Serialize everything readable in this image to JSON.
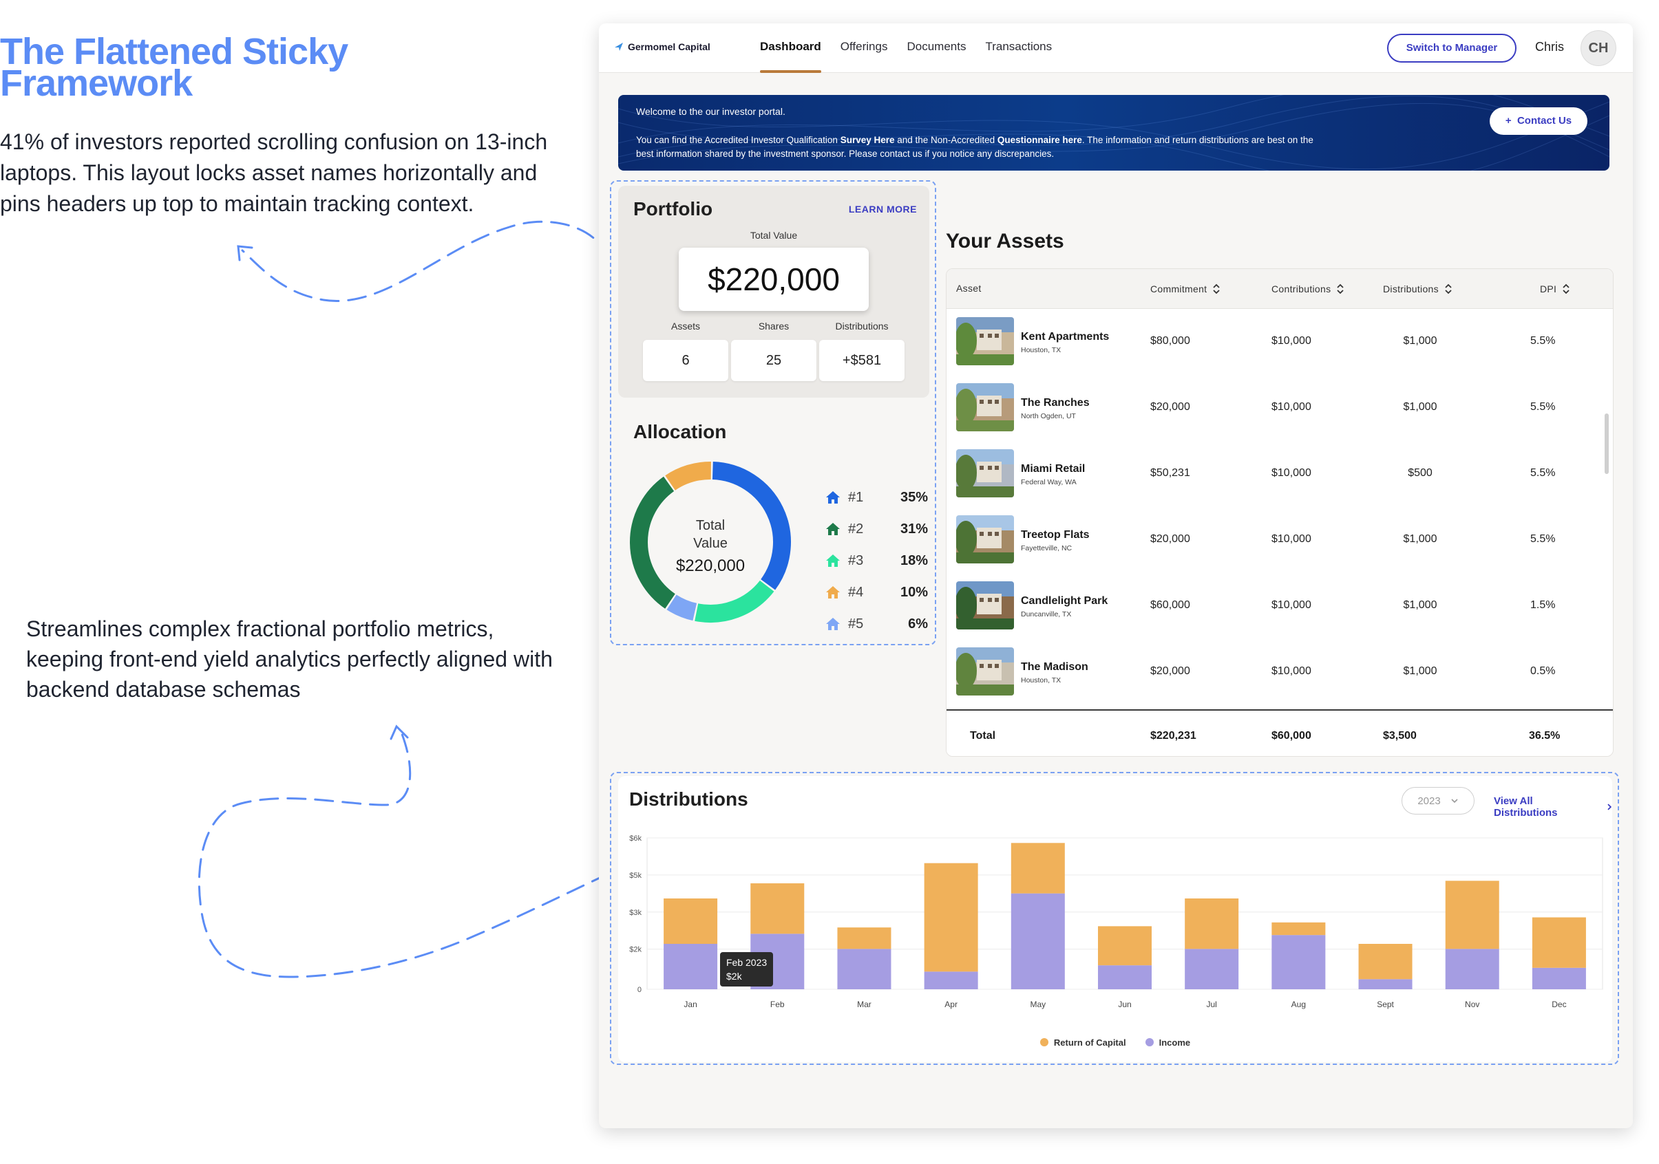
{
  "annotations": {
    "title": "The Flattened Sticky Framework",
    "text1": "41% of investors reported scrolling confusion on 13-inch laptops. This layout locks asset names horizontally and pins headers up top to maintain tracking context.",
    "text2": "Streamlines complex fractional portfolio metrics, keeping front-end yield analytics perfectly aligned with backend database schemas"
  },
  "nav": {
    "brand": "Germomel Capital",
    "tabs": [
      "Dashboard",
      "Offerings",
      "Documents",
      "Transactions"
    ],
    "active_tab": "Dashboard",
    "switch_label": "Switch to Manager",
    "user_name": "Chris",
    "avatar_initials": "CH"
  },
  "banner": {
    "welcome": "Welcome to the our investor portal.",
    "body_1": "You can find the Accredited Investor Qualification ",
    "body_link1": "Survey Here",
    "body_2": " and the Non-Accredited ",
    "body_link2": "Questionnaire here",
    "body_3": ". The information and return distributions are best on the best information shared by the investment sponsor. Please contact us if you notice any discrepancies.",
    "contact_label": "Contact Us",
    "contact_icon": "plus-icon"
  },
  "portfolio": {
    "title": "Portfolio",
    "learn_more": "LEARN MORE",
    "total_label": "Total Value",
    "total_value": "$220,000",
    "stats": [
      {
        "label": "Assets",
        "value": "6"
      },
      {
        "label": "Shares",
        "value": "25"
      },
      {
        "label": "Distributions",
        "value": "+$581"
      }
    ]
  },
  "allocation": {
    "title": "Allocation",
    "center_label_1": "Total",
    "center_label_2": "Value",
    "center_value": "$220,000",
    "items": [
      {
        "rank": "#1",
        "pct": "35%",
        "share": 35,
        "color": "#1f66e0"
      },
      {
        "rank": "#2",
        "pct": "31%",
        "share": 31,
        "color": "#1e7a4a"
      },
      {
        "rank": "#3",
        "pct": "18%",
        "share": 18,
        "color": "#2be39e"
      },
      {
        "rank": "#4",
        "pct": "10%",
        "share": 10,
        "color": "#f0ab4b"
      },
      {
        "rank": "#5",
        "pct": "6%",
        "share": 6,
        "color": "#7ea6f5"
      }
    ]
  },
  "assets": {
    "title": "Your Assets",
    "columns": [
      "Asset",
      "Commitment",
      "Contributions",
      "Distributions",
      "DPI"
    ],
    "rows": [
      {
        "name": "Kent Apartments",
        "location": "Houston, TX",
        "commitment": "$80,000",
        "contributions": "$10,000",
        "distributions": "$1,000",
        "dpi": "5.5%"
      },
      {
        "name": "The Ranches",
        "location": "North Ogden, UT",
        "commitment": "$20,000",
        "contributions": "$10,000",
        "distributions": "$1,000",
        "dpi": "5.5%"
      },
      {
        "name": "Miami Retail",
        "location": "Federal Way, WA",
        "commitment": "$50,231",
        "contributions": "$10,000",
        "distributions": "$500",
        "dpi": "5.5%"
      },
      {
        "name": "Treetop Flats",
        "location": "Fayetteville, NC",
        "commitment": "$20,000",
        "contributions": "$10,000",
        "distributions": "$1,000",
        "dpi": "5.5%"
      },
      {
        "name": "Candlelight Park",
        "location": "Duncanville, TX",
        "commitment": "$60,000",
        "contributions": "$10,000",
        "distributions": "$1,000",
        "dpi": "1.5%"
      },
      {
        "name": "The Madison",
        "location": "Houston, TX",
        "commitment": "$20,000",
        "contributions": "$10,000",
        "distributions": "$1,000",
        "dpi": "0.5%"
      }
    ],
    "total": {
      "label": "Total",
      "commitment": "$220,231",
      "contributions": "$60,000",
      "distributions": "$3,500",
      "dpi": "36.5%"
    }
  },
  "distributions": {
    "title": "Distributions",
    "year": "2023",
    "view_all": "View All Distributions",
    "tooltip_line1": "Feb 2023",
    "tooltip_line2": "$2k",
    "legend": [
      {
        "name": "Return of Capital",
        "color": "#f0b15a"
      },
      {
        "name": "Income",
        "color": "#a59de2"
      }
    ]
  },
  "chart_data": {
    "type": "bar",
    "stacked": true,
    "categories": [
      "Jan",
      "Feb",
      "Mar",
      "Apr",
      "May",
      "Jun",
      "Jul",
      "Aug",
      "Sept",
      "Nov",
      "Dec"
    ],
    "series": [
      {
        "name": "Income",
        "color": "#a59de2",
        "values": [
          1.8,
          2.2,
          1.6,
          0.7,
          3.8,
          0.95,
          1.6,
          2.15,
          0.4,
          1.6,
          0.85
        ]
      },
      {
        "name": "Return of Capital",
        "color": "#f0b15a",
        "values": [
          1.8,
          2.0,
          0.85,
          4.3,
          2.0,
          1.55,
          2.0,
          0.5,
          1.4,
          2.7,
          2.0
        ]
      }
    ],
    "y_ticks": [
      "$6k",
      "$5k",
      "$3k",
      "$2k",
      "0"
    ],
    "ylim": [
      0,
      6
    ],
    "grid": true,
    "legend_position": "bottom"
  }
}
